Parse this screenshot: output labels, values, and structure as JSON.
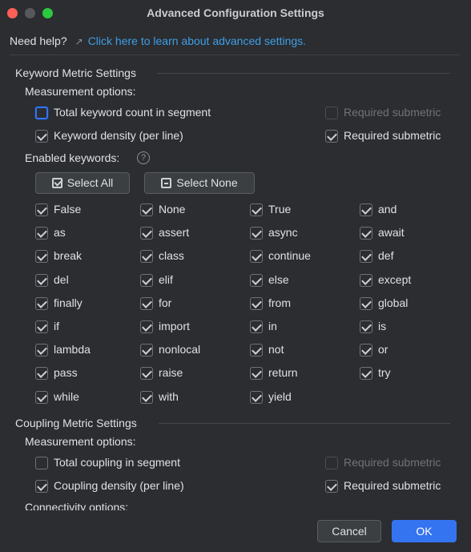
{
  "window": {
    "title": "Advanced Configuration Settings"
  },
  "help": {
    "label": "Need help?",
    "arrow": "↗",
    "link_text": "Click here to learn about advanced settings."
  },
  "keyword_section": {
    "title": "Keyword Metric Settings",
    "measurement_label": "Measurement options:",
    "options": [
      {
        "label": "Total keyword count in segment",
        "checked": false,
        "submetric_label": "Required submetric",
        "submetric_checked": false,
        "submetric_enabled": false
      },
      {
        "label": "Keyword density (per line)",
        "checked": true,
        "submetric_label": "Required submetric",
        "submetric_checked": true,
        "submetric_enabled": true
      }
    ],
    "enabled_label": "Enabled keywords:",
    "help_icon": "?",
    "select_all": "Select All",
    "select_none": "Select None",
    "keywords": [
      "False",
      "None",
      "True",
      "and",
      "as",
      "assert",
      "async",
      "await",
      "break",
      "class",
      "continue",
      "def",
      "del",
      "elif",
      "else",
      "except",
      "finally",
      "for",
      "from",
      "global",
      "if",
      "import",
      "in",
      "is",
      "lambda",
      "nonlocal",
      "not",
      "or",
      "pass",
      "raise",
      "return",
      "try",
      "while",
      "with",
      "yield"
    ]
  },
  "coupling_section": {
    "title": "Coupling Metric Settings",
    "measurement_label": "Measurement options:",
    "options": [
      {
        "label": "Total coupling in segment",
        "checked": false,
        "submetric_label": "Required submetric",
        "submetric_checked": false,
        "submetric_enabled": false
      },
      {
        "label": "Coupling density (per line)",
        "checked": true,
        "submetric_label": "Required submetric",
        "submetric_checked": true,
        "submetric_enabled": true
      }
    ],
    "connectivity_label": "Connectivity options:"
  },
  "footer": {
    "cancel": "Cancel",
    "ok": "OK"
  },
  "colors": {
    "background": "#2b2d30",
    "link": "#3f9ee7",
    "primary_button": "#3574f0",
    "traffic_close": "#fe5f57",
    "traffic_max": "#2bc840"
  }
}
